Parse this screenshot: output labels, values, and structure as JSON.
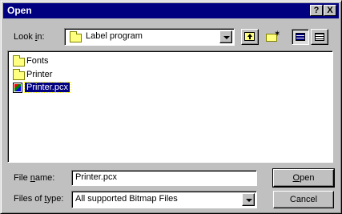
{
  "window": {
    "title": "Open",
    "help_label": "?",
    "close_label": "X"
  },
  "lookin": {
    "label_prefix": "Look ",
    "label_mnemonic": "i",
    "label_suffix": "n:",
    "value": "Label program"
  },
  "toolbar": {
    "icons": [
      "up-one-level-icon",
      "create-new-folder-icon",
      "list-view-icon",
      "details-view-icon"
    ]
  },
  "file_list": {
    "items": [
      {
        "label": "Fonts",
        "icon": "folder-icon",
        "selected": false
      },
      {
        "label": "Printer",
        "icon": "folder-icon",
        "selected": false
      },
      {
        "label": "Printer.pcx",
        "icon": "bitmap-file-icon",
        "selected": true
      }
    ]
  },
  "filename": {
    "label_prefix": "File ",
    "label_mnemonic": "n",
    "label_suffix": "ame:",
    "value": "Printer.pcx"
  },
  "filetype": {
    "label_prefix": "Files of ",
    "label_mnemonic": "t",
    "label_suffix": "ype:",
    "value": "All supported Bitmap Files"
  },
  "buttons": {
    "open_mnemonic": "O",
    "open_rest": "pen",
    "cancel": "Cancel"
  },
  "colors": {
    "titlebar": "#000080",
    "face": "#c0c0c0",
    "selection": "#000080"
  }
}
